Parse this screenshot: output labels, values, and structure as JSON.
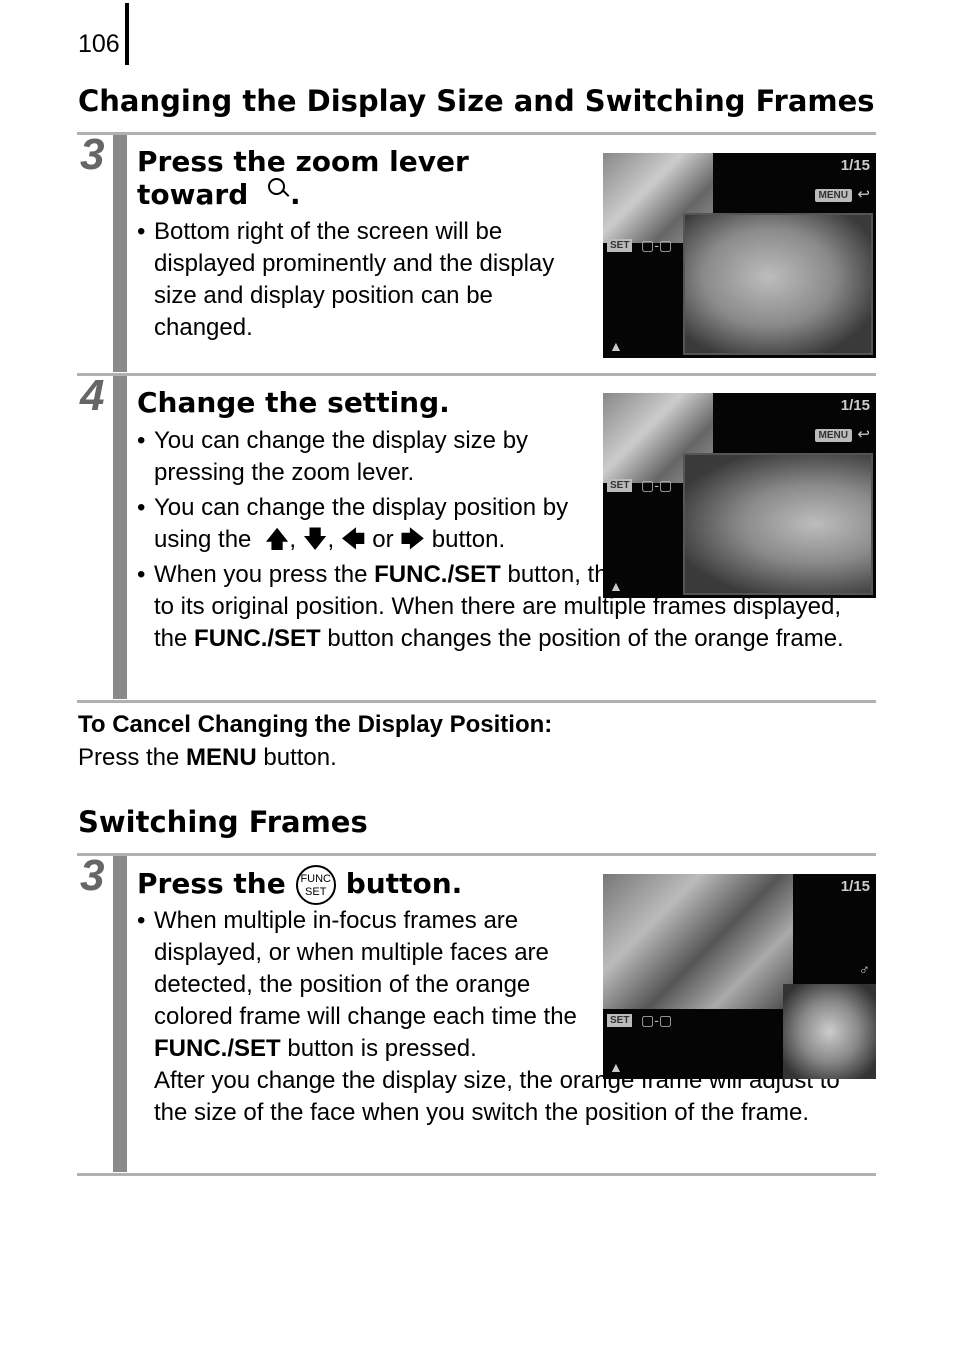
{
  "page_number": "106",
  "section1": {
    "title": "Changing the Display Size and Switching Frames",
    "step3": {
      "number": "3",
      "heading_line1": "Press the zoom lever",
      "heading_line2": "toward",
      "heading_icon": "magnify-icon",
      "bullets": [
        "Bottom right of the screen will be displayed prominently and the display size and display position can be changed."
      ],
      "screen": {
        "counter": "1/15",
        "menu": "MENU",
        "set": "SET"
      }
    },
    "step4": {
      "number": "4",
      "heading": "Change the setting.",
      "bullet1": "You can change the display size by pressing the zoom lever.",
      "bullet2_pre": "You can change the display position by using the",
      "bullet2_or": "or",
      "bullet2_post": "button.",
      "bullet3_a": "When you press the ",
      "bullet3_b": "FUNC./SET",
      "bullet3_c": " button, the orange frame returns to its original position. When there are multiple frames displayed, the ",
      "bullet3_d": "FUNC./SET",
      "bullet3_e": " button changes the position of the orange frame.",
      "screen": {
        "counter": "1/15",
        "menu": "MENU",
        "set": "SET"
      }
    }
  },
  "cancel": {
    "title": "To Cancel Changing the Display Position:",
    "text_a": "Press the ",
    "text_b": "MENU",
    "text_c": " button."
  },
  "section2": {
    "title": "Switching Frames",
    "step3": {
      "number": "3",
      "heading_pre": "Press the",
      "func_icon_top": "FUNC",
      "func_icon_bottom": "SET",
      "heading_post": "button.",
      "bullet_a": "When multiple in-focus frames are displayed, or when multiple faces are detected, the position of the orange colored frame will change each time the ",
      "bullet_b": "FUNC./SET",
      "bullet_c": " button is pressed.",
      "para": "After you change the display size, the orange frame will adjust to the size of the face when you switch the position of the frame.",
      "screen": {
        "counter": "1/15",
        "set": "SET"
      }
    }
  }
}
